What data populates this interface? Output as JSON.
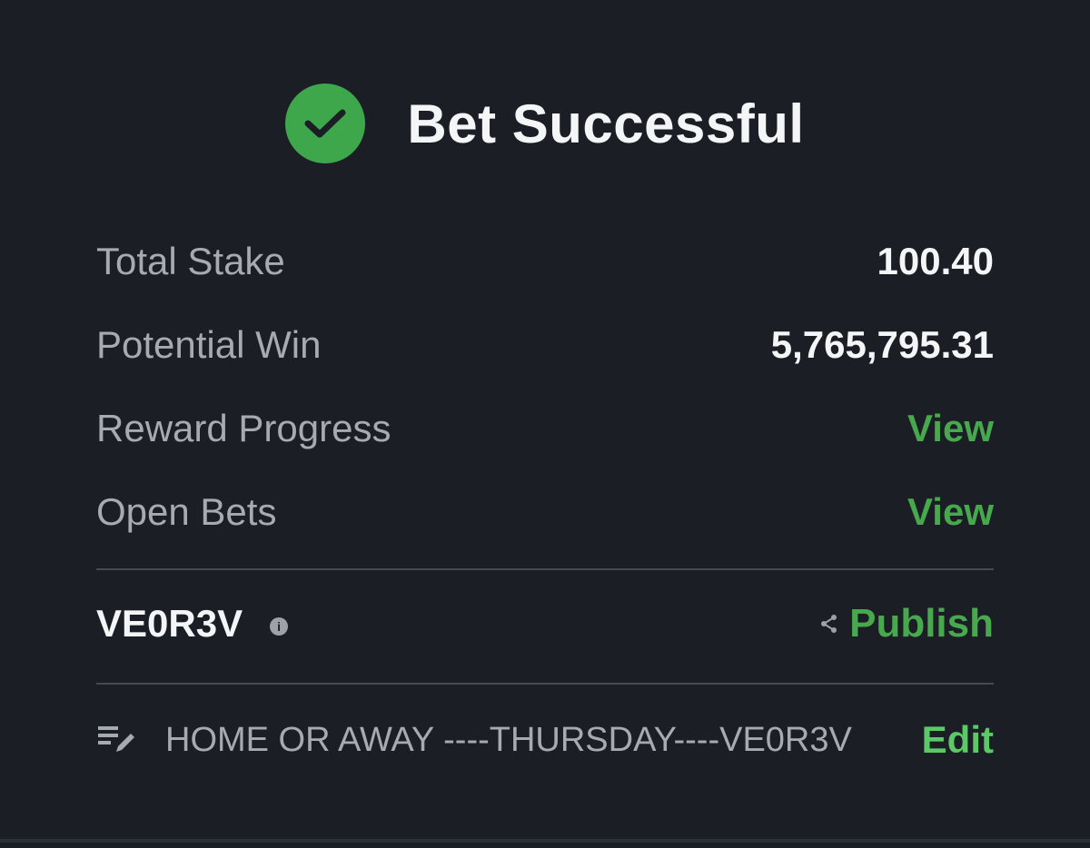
{
  "header": {
    "title": "Bet Successful",
    "icon": "check-circle-icon",
    "accent_color": "#3ea74b"
  },
  "summary": {
    "total_stake": {
      "label": "Total Stake",
      "value": "100.40"
    },
    "potential_win": {
      "label": "Potential Win",
      "value": "5,765,795.31"
    },
    "reward_progress": {
      "label": "Reward Progress",
      "link": "View"
    },
    "open_bets": {
      "label": "Open Bets",
      "link": "View"
    }
  },
  "booking": {
    "code": "VE0R3V",
    "info_icon": "info-icon",
    "share_icon": "share-icon",
    "publish_label": "Publish"
  },
  "bet_name": {
    "icon": "edit-note-icon",
    "text": "HOME OR AWAY ----THURSDAY----VE0R3V",
    "edit_label": "Edit"
  },
  "colors": {
    "background": "#1b1e25",
    "link_green": "#47a84e",
    "label_gray": "#a6aab3",
    "divider": "#454a54"
  }
}
